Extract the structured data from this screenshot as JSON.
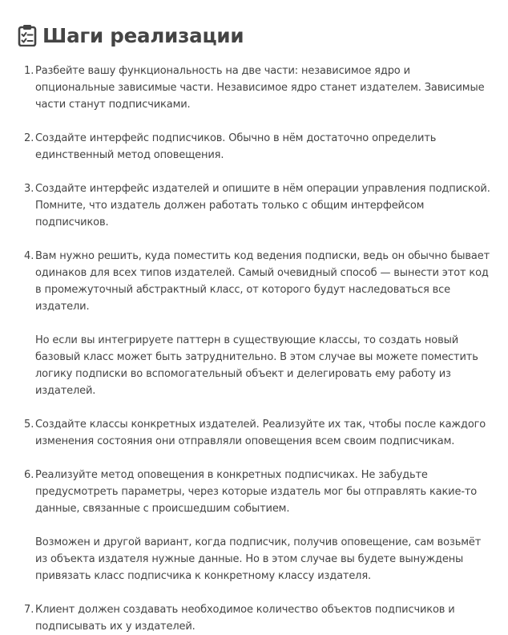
{
  "heading": {
    "icon": "clipboard-checklist-icon",
    "title": "Шаги реализации"
  },
  "steps": [
    {
      "number": "1.",
      "paragraphs": [
        "Разбейте вашу функциональность на две части: независимое ядро и опциональные зависимые части. Независимое ядро станет издателем. Зависимые части станут подписчиками."
      ]
    },
    {
      "number": "2.",
      "paragraphs": [
        "Создайте интерфейс подписчиков. Обычно в нём достаточно определить единственный метод оповещения."
      ]
    },
    {
      "number": "3.",
      "paragraphs": [
        "Создайте интерфейс издателей и опишите в нём операции управления подпиской. Помните, что издатель должен работать только с общим интерфейсом подписчиков."
      ]
    },
    {
      "number": "4.",
      "paragraphs": [
        "Вам нужно решить, куда поместить код ведения подписки, ведь он обычно бывает одинаков для всех типов издателей. Самый очевидный способ — вынести этот код в промежуточный абстрактный класс, от которого будут наследоваться все издатели.",
        "Но если вы интегрируете паттерн в существующие классы, то создать новый базовый класс может быть затруднительно. В этом случае вы можете поместить логику подписки во вспомогательный объект и делегировать ему работу из издателей."
      ]
    },
    {
      "number": "5.",
      "paragraphs": [
        "Создайте классы конкретных издателей. Реализуйте их так, чтобы после каждого изменения состояния они отправляли оповещения всем своим подписчикам."
      ]
    },
    {
      "number": "6.",
      "paragraphs": [
        "Реализуйте метод оповещения в конкретных подписчиках. Не забудьте предусмотреть параметры, через которые издатель мог бы отправлять какие-то данные, связанные с происшедшим событием.",
        "Возможен и другой вариант, когда подписчик, получив оповещение, сам возьмёт из объекта издателя нужные данные. Но в этом случае вы будете вынуждены привязать класс подписчика к конкретному классу издателя."
      ]
    },
    {
      "number": "7.",
      "paragraphs": [
        "Клиент должен создавать необходимое количество объектов подписчиков и подписывать их у издателей."
      ]
    }
  ]
}
